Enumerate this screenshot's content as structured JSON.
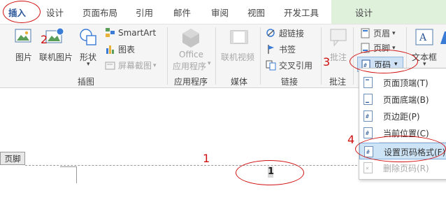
{
  "tabs": [
    {
      "label": "插入",
      "active": true
    },
    {
      "label": "设计"
    },
    {
      "label": "页面布局"
    },
    {
      "label": "引用"
    },
    {
      "label": "邮件"
    },
    {
      "label": "审阅"
    },
    {
      "label": "视图"
    },
    {
      "label": "开发工具"
    },
    {
      "label": "设计",
      "contextual": true
    }
  ],
  "ribbon": {
    "illustrations": {
      "group_label": "插图",
      "picture": "图片",
      "online_picture": "联机图片",
      "shapes": "形状",
      "smartart": "SmartArt",
      "chart": "图表",
      "screenshot": "屏幕截图"
    },
    "apps": {
      "group_label": "应用程序",
      "office_line1": "Office",
      "office_line2": "应用程序"
    },
    "media": {
      "group_label": "媒体",
      "online_video": "联机视频"
    },
    "links": {
      "group_label": "链接",
      "hyperlink": "超链接",
      "bookmark": "书签",
      "cross_reference": "交叉引用"
    },
    "comments": {
      "group_label": "批注",
      "comment": "批注"
    },
    "header_footer": {
      "header": "页眉",
      "footer": "页脚",
      "page_number": "页码"
    },
    "text": {
      "textbox_line1": "文本框",
      "textbox_arrow": "▾"
    }
  },
  "page_number_menu": {
    "items": [
      {
        "label": "页面顶端(T)",
        "icon": "page-top-icon"
      },
      {
        "label": "页面底端(B)",
        "icon": "page-bottom-icon"
      },
      {
        "label": "页边距(P)",
        "icon": "page-margin-icon"
      },
      {
        "label": "当前位置(C)",
        "icon": "current-position-icon"
      },
      {
        "label": "设置页码格式(F)...",
        "icon": "format-page-number-icon",
        "highlighted": true
      },
      {
        "label": "删除页码(R)",
        "icon": "remove-page-number-icon",
        "disabled": true
      }
    ]
  },
  "document": {
    "footer_tag": "页脚",
    "page_number_field": "1"
  },
  "annotations": {
    "step1": "1",
    "step2": "2",
    "step3": "3",
    "step4": "4",
    "color": "#d01010"
  },
  "colors": {
    "accent": "#2b579a",
    "contextual_tab_band": "#dff0db",
    "menu_highlight": "#cde4f7"
  }
}
